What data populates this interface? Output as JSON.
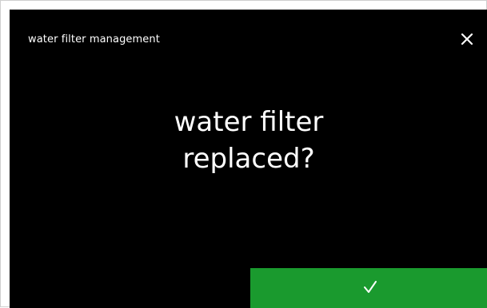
{
  "header": {
    "title": "water filter management",
    "close_icon": "close-icon"
  },
  "dialog": {
    "question_line1": "water filter",
    "question_line2": "replaced?"
  },
  "confirm": {
    "icon": "checkmark-icon",
    "color": "#1a9a2e"
  },
  "colors": {
    "screen_background": "#000000",
    "text": "#ffffff",
    "accent_green": "#1a9a2e"
  }
}
